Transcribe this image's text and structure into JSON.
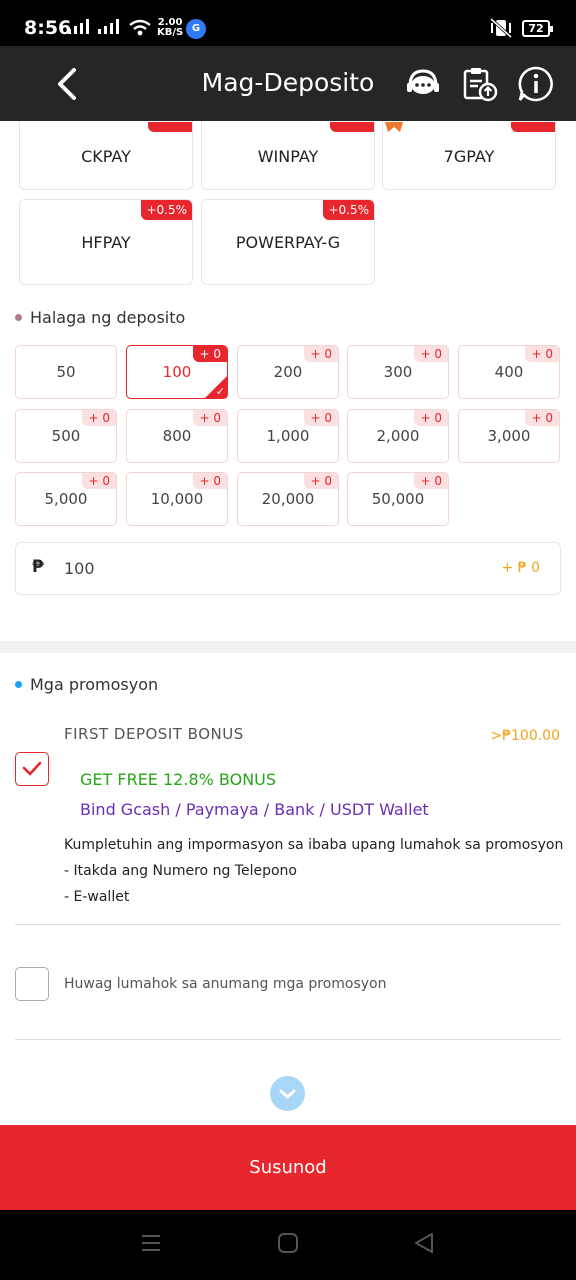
{
  "status_bar": {
    "time": "8:56",
    "speed_value": "2.00",
    "speed_unit": "KB/S",
    "app_badge": "G",
    "battery": "72"
  },
  "header": {
    "title": "Mag-Deposito"
  },
  "channels": [
    {
      "label": "CKPAY",
      "tag": ""
    },
    {
      "label": "WINPAY",
      "tag": ""
    },
    {
      "label": "7GPAY",
      "tag": ""
    },
    {
      "label": "HFPAY",
      "tag": "+0.5%"
    },
    {
      "label": "POWERPAY-G",
      "tag": "+0.5%"
    }
  ],
  "amount_section": {
    "title": "Halaga ng deposito",
    "options": [
      {
        "value": "50",
        "bonus": ""
      },
      {
        "value": "100",
        "bonus": "+ 0",
        "selected": true
      },
      {
        "value": "200",
        "bonus": "+ 0"
      },
      {
        "value": "300",
        "bonus": "+ 0"
      },
      {
        "value": "400",
        "bonus": "+ 0"
      },
      {
        "value": "500",
        "bonus": "+ 0"
      },
      {
        "value": "800",
        "bonus": "+ 0"
      },
      {
        "value": "1,000",
        "bonus": "+ 0"
      },
      {
        "value": "2,000",
        "bonus": "+ 0"
      },
      {
        "value": "3,000",
        "bonus": "+ 0"
      },
      {
        "value": "5,000",
        "bonus": "+ 0"
      },
      {
        "value": "10,000",
        "bonus": "+ 0"
      },
      {
        "value": "20,000",
        "bonus": "+ 0"
      },
      {
        "value": "50,000",
        "bonus": "+ 0"
      }
    ],
    "currency_symbol": "₱",
    "input_value": "100",
    "bonus_preview": "+ ₱ 0"
  },
  "promotions": {
    "title": "Mga promosyon",
    "first_bonus": {
      "name": "FIRST DEPOSIT BONUS",
      "amount": ">₱100.00",
      "checked": true,
      "headline": "GET FREE 12.8% BONUS",
      "sub": "Bind Gcash / Paymaya / Bank / USDT Wallet",
      "desc": "Kumpletuhin ang impormasyon sa ibaba upang lumahok sa promosyon",
      "req1": "- Itakda ang Numero ng Telepono",
      "req2": "- E-wallet"
    },
    "no_promo_label": "Huwag lumahok sa anumang mga promosyon"
  },
  "submit_label": "Susunod",
  "colors": {
    "accent": "#e8262d",
    "header_bg": "#262626",
    "bonus_orange": "#f3a21b",
    "green": "#26a616",
    "purple": "#6a2fb5"
  }
}
